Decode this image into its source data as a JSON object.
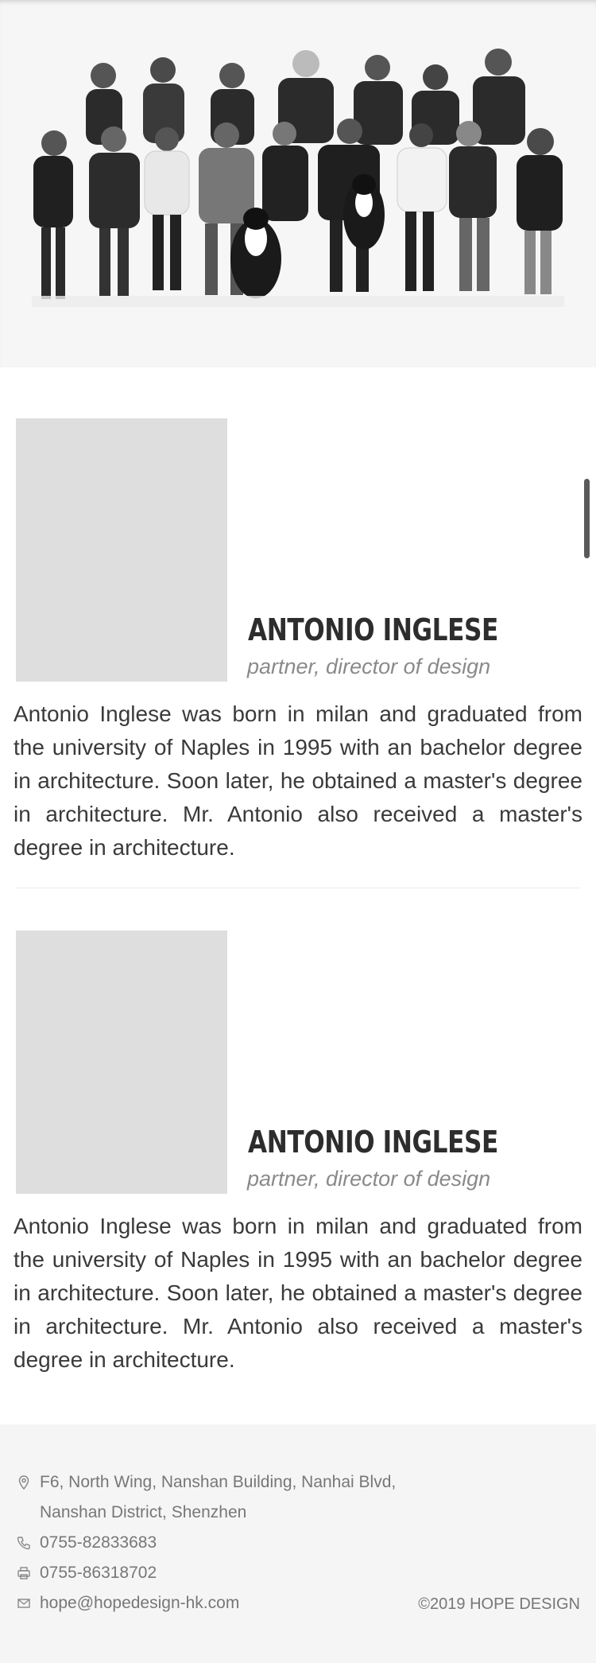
{
  "team_photo": {
    "alt": "team-group-photo"
  },
  "members": [
    {
      "name": "ANTONIO INGLESE",
      "role": "partner, director of design",
      "bio": "Antonio Inglese was born in milan and graduated from the university of Naples in 1995 with an bachelor degree in architecture. Soon later, he obtained a master's degree in architecture. Mr. Antonio also received a master's degree in architecture."
    },
    {
      "name": "ANTONIO INGLESE",
      "role": "partner, director of design",
      "bio": "Antonio Inglese was born in milan and graduated from the university of Naples in 1995 with an bachelor degree in architecture. Soon later, he obtained a master's degree in architecture. Mr. Antonio also received a master's degree in architecture."
    }
  ],
  "footer": {
    "address_line1": "F6, North Wing, Nanshan Building, Nanhai Blvd,",
    "address_line2": "Nanshan District, Shenzhen",
    "phone": "0755-82833683",
    "fax": "0755-86318702",
    "email": "hope@hopedesign-hk.com",
    "copyright": "©2019 HOPE DESIGN",
    "icons": [
      "location-pin-icon",
      "phone-icon",
      "fax-icon",
      "mail-icon"
    ]
  },
  "colors": {
    "hero_bg": "#f6f6f6",
    "photo_placeholder": "#dedede",
    "footer_bg": "#f5f5f5",
    "text_dark": "#2d2d2d",
    "text_muted": "#8a8a8a"
  }
}
